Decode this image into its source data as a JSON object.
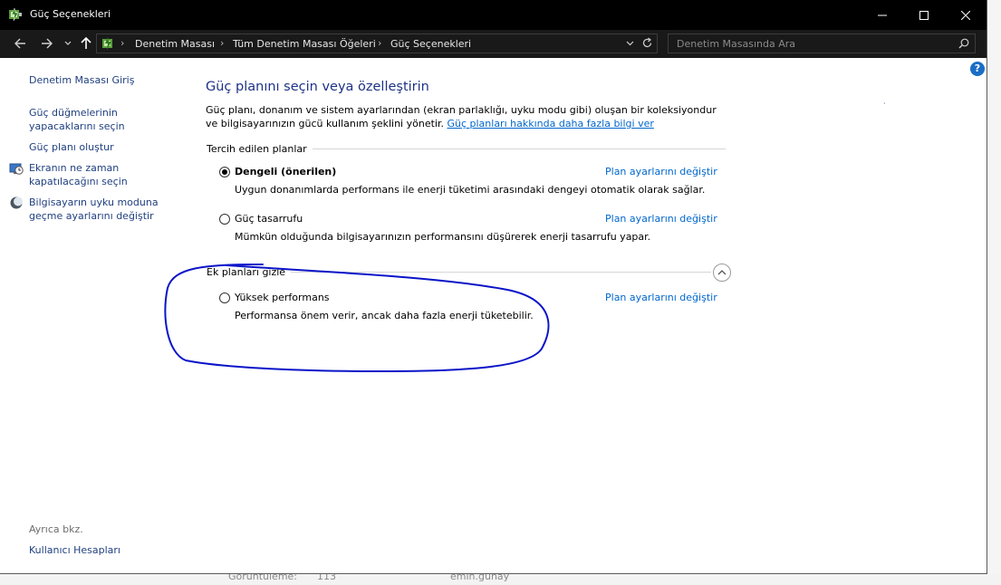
{
  "window": {
    "title": "Güç Seçenekleri"
  },
  "address": {
    "crumbs": [
      "Denetim Masası",
      "Tüm Denetim Masası Öğeleri",
      "Güç Seçenekleri"
    ],
    "search_placeholder": "Denetim Masasında Ara"
  },
  "sidebar": {
    "home": "Denetim Masası Giriş",
    "links": [
      "Güç düğmelerinin yapacaklarını seçin",
      "Güç planı oluştur",
      "Ekranın ne zaman kapatılacağını seçin",
      "Bilgisayarın uyku moduna geçme ayarlarını değiştir"
    ],
    "see_also_label": "Ayrıca bkz.",
    "see_also_links": [
      "Kullanıcı Hesapları"
    ]
  },
  "main": {
    "heading": "Güç planını seçin veya özelleştirin",
    "description": "Güç planı, donanım ve sistem ayarlarından (ekran parlaklığı, uyku modu gibi) oluşan bir koleksiyondur ve bilgisayarınızın gücü kullanım şeklini yönetir.",
    "description_link": "Güç planları hakkında daha fazla bilgi ver",
    "preferred_group": "Tercih edilen planlar",
    "extra_group": "Ek planları gizle",
    "plans": [
      {
        "name": "Dengeli (önerilen)",
        "description": "Uygun donanımlarda performans ile enerji tüketimi arasındaki dengeyi otomatik olarak sağlar.",
        "link": "Plan ayarlarını değiştir",
        "selected": true
      },
      {
        "name": "Güç tasarrufu",
        "description": "Mümkün olduğunda bilgisayarınızın performansını düşürerek enerji tasarrufu yapar.",
        "link": "Plan ayarlarını değiştir",
        "selected": false
      }
    ],
    "extra_plans": [
      {
        "name": "Yüksek performans",
        "description": "Performansa önem verir, ancak daha fazla enerji tüketebilir.",
        "link": "Plan ayarlarını değiştir",
        "selected": false
      }
    ]
  },
  "background": {
    "views_label": "Görüntüleme:",
    "views_count": "113",
    "username": "emin.gunay"
  },
  "colors": {
    "titlebar": "#000000",
    "link": "#0066cc",
    "heading": "#1e3287",
    "annotation": "#0a14c8"
  },
  "icons": {
    "app": "power-options-icon",
    "help": "help-icon",
    "collapse": "chevron-up-icon"
  }
}
